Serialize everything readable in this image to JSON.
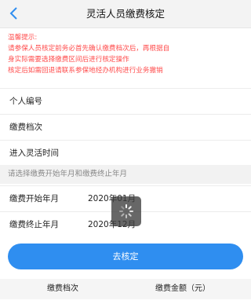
{
  "header": {
    "title": "灵活人员缴费核定"
  },
  "notice": {
    "lines": [
      "温馨提示:",
      "请参保人员核定前务必首先确认缴费档次后，再根据自",
      "身实际需要选择缴费区间后进行核定操作",
      "核定后如需回退请联系参保地经办机构进行业务撤销"
    ]
  },
  "fields": {
    "personal_id_label": "个人编号",
    "payment_grade_label": "缴费档次",
    "entry_time_label": "进入灵活时间",
    "section_hint": "请选择缴费开始年月和缴费终止年月",
    "start_label": "缴费开始年月",
    "start_value": "2020年01月",
    "end_label": "缴费终止年月",
    "end_value": "2020年12月"
  },
  "actions": {
    "confirm_label": "去核定"
  },
  "table": {
    "columns": [
      "缴费档次",
      "缴费金额（元）"
    ]
  },
  "colors": {
    "accent": "#2f8ef0",
    "warning": "#ff4d4d"
  }
}
